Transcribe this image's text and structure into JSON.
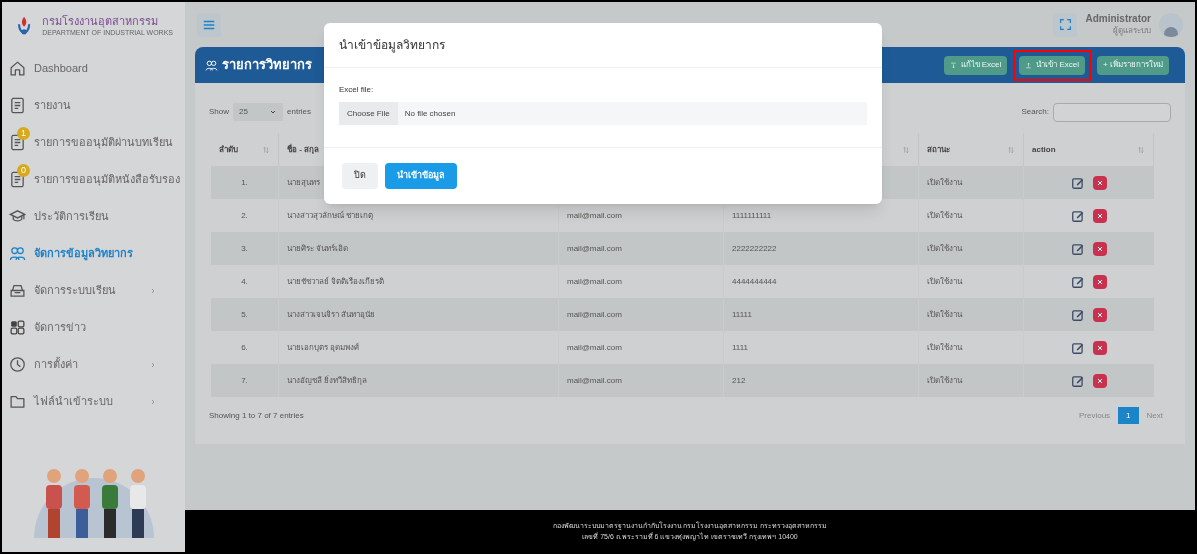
{
  "sidebar": {
    "logo": {
      "title": "กรมโรงงานอุตสาหกรรม",
      "subtitle": "DEPARTMENT OF INDUSTRIAL WORKS"
    },
    "items": [
      {
        "label": "Dashboard",
        "kind": "home",
        "selected": false,
        "submenu": false
      },
      {
        "label": "รายงาน",
        "kind": "document",
        "selected": false,
        "submenu": false
      },
      {
        "label": "รายการขออนุมัติผ่านบทเรียน",
        "kind": "document",
        "selected": false,
        "submenu": false,
        "badge": "1"
      },
      {
        "label": "รายการขออนุมัติหนังสือรับรอง",
        "kind": "document",
        "selected": false,
        "submenu": false,
        "badge": "0"
      },
      {
        "label": "ประวัติการเรียน",
        "kind": "graduation",
        "selected": false,
        "submenu": false
      },
      {
        "label": "จัดการข้อมูลวิทยากร",
        "kind": "users",
        "selected": true,
        "submenu": false
      },
      {
        "label": "จัดการระบบเรียน",
        "kind": "tray",
        "selected": false,
        "submenu": true
      },
      {
        "label": "จัดการข่าว",
        "kind": "grid",
        "selected": false,
        "submenu": false
      },
      {
        "label": "การตั้งค่า",
        "kind": "clock",
        "selected": false,
        "submenu": true
      },
      {
        "label": "ไฟล์นำเข้าระบบ",
        "kind": "folder",
        "selected": false,
        "submenu": true
      }
    ]
  },
  "topbar": {
    "user": "Administrator",
    "role": "ผู้ดูแลระบบ"
  },
  "page": {
    "title": "รายการวิทยากร",
    "buttons": [
      {
        "label": "แก้ไข Excel",
        "kind": "download",
        "highlighted": false
      },
      {
        "label": "นำเข้า Excel",
        "kind": "upload",
        "highlighted": true
      },
      {
        "label": "+ เพิ่มรายการใหม่",
        "kind": "add",
        "highlighted": false
      }
    ]
  },
  "table": {
    "show_label": "Show",
    "page_size": "25",
    "entries_label": "entries",
    "search_label": "Search:",
    "columns": [
      {
        "label": "ลำดับ",
        "sort_icon": true
      },
      {
        "label": "ชื่อ - สกุล",
        "sort_icon": false
      },
      null,
      {
        "sort_icon": true
      },
      {
        "label": "สถานะ",
        "sort_icon": true
      },
      {
        "label": "action",
        "sort_icon": true
      }
    ],
    "rows": [
      [
        "1.",
        "นายสุนทร",
        null,
        null,
        "เปิดใช้งาน"
      ],
      [
        "2.",
        "นางสาวสุวลักษณ์ ชายเกตุ",
        "mail@mail.com",
        "1111111111",
        "เปิดใช้งาน"
      ],
      [
        "3.",
        "นายศิระ จันทร์เอิด",
        "mail@mail.com",
        "2222222222",
        "เปิดใช้งาน"
      ],
      [
        "4.",
        "นายชัชวาลย์ จิตติเรืองเกียรติ",
        "mail@mail.com",
        "4444444444",
        "เปิดใช้งาน"
      ],
      [
        "5.",
        "นางสาวเจนจิรา สันทาอุนัย",
        "mail@mail.com",
        "11111",
        "เปิดใช้งาน"
      ],
      [
        "6.",
        "นายเอกบุตร อุดมพงศ์",
        "mail@mail.com",
        "1111",
        "เปิดใช้งาน"
      ],
      [
        "7.",
        "นางอัญชลี ยิ่งทวีสิทธิกุล",
        "mail@mail.com",
        "212",
        "เปิดใช้งาน"
      ]
    ],
    "info": "Showing 1 to 7 of 7 entries",
    "pagination": [
      {
        "label": "Previous",
        "selected": false
      },
      {
        "label": "1",
        "selected": true
      },
      {
        "label": "Next",
        "selected": false
      }
    ]
  },
  "modal": {
    "title": "นำเข้าข้อมูลวิทยากร",
    "field_label": "Excel file:",
    "choose_button": "Choose File",
    "file_status": "No file chosen",
    "buttons": [
      {
        "label": "ปิด",
        "kind": "secondary"
      },
      {
        "label": "นำเข้าข้อมูล",
        "kind": "primary"
      }
    ]
  },
  "footer": {
    "lines": [
      "กองพัฒนาระบบมาตรฐานงานกำกับโรงงาน กรมโรงงานอุตสาหกรรม กระทรวงอุตสาหกรรม",
      "เลขที่ 75/6 ถ.พระรามที่ 6 แขวงทุ่งพญาไท เขตราชเทวี กรุงเทพฯ 10400"
    ]
  }
}
